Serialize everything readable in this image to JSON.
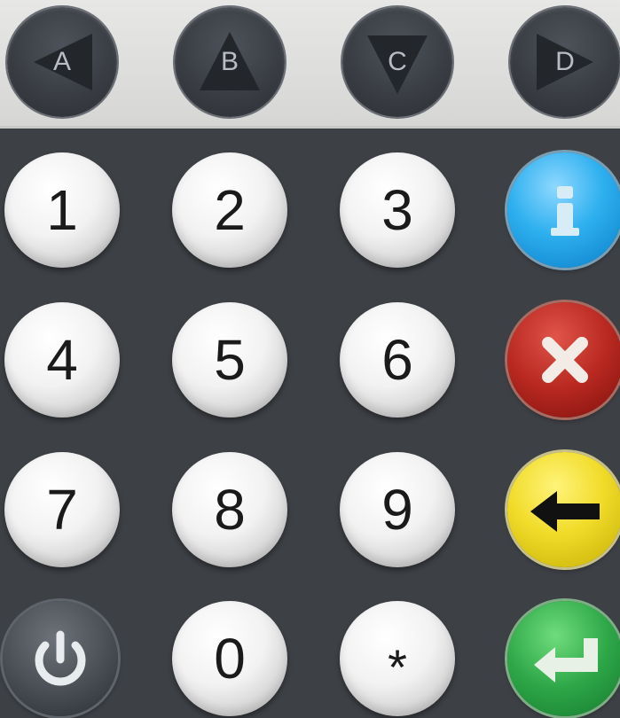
{
  "function_keys": [
    {
      "label": "A",
      "icon": "arrow-left-icon"
    },
    {
      "label": "B",
      "icon": "arrow-up-icon"
    },
    {
      "label": "C",
      "icon": "arrow-down-icon"
    },
    {
      "label": "D",
      "icon": "arrow-right-icon"
    }
  ],
  "digits": [
    "1",
    "2",
    "3",
    "4",
    "5",
    "6",
    "7",
    "8",
    "9",
    "0",
    "*"
  ],
  "side_keys": [
    {
      "icon": "info-icon",
      "color": "#1e9fe3"
    },
    {
      "icon": "cancel-x-icon",
      "color": "#b82820"
    },
    {
      "icon": "backspace-arrow-icon",
      "color": "#e6d21d"
    },
    {
      "icon": "enter-return-icon",
      "color": "#2ea748"
    }
  ],
  "power_key": {
    "icon": "power-icon"
  },
  "colors": {
    "panel": "#3d4045",
    "top_strip": "#e2e2e1",
    "function_key": "#3a3e44"
  }
}
